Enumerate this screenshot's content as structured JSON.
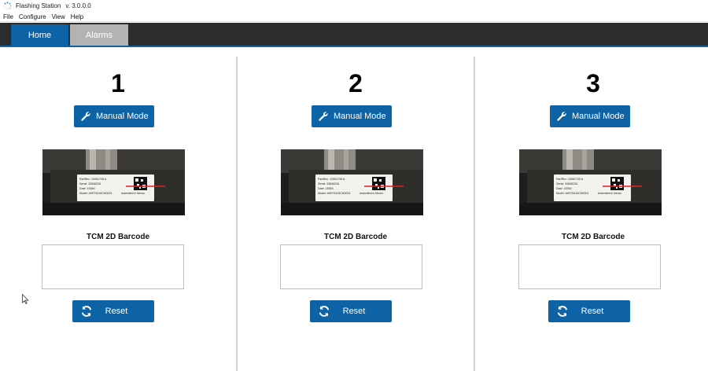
{
  "window": {
    "title": "Flashing Station",
    "version": "v. 3.0.0.0"
  },
  "menu": [
    "File",
    "Configure",
    "View",
    "Help"
  ],
  "tabs": {
    "home": "Home",
    "alarms": "Alarms"
  },
  "colors": {
    "accent": "#0d63a6",
    "tab_inactive": "#b3b3b3",
    "tabbar_bg": "#2c2c2c"
  },
  "stations": [
    {
      "number": "1",
      "manual_label": "Manual Mode",
      "barcode_label": "TCM 2D Barcode",
      "barcode_value": "",
      "reset_label": "Reset",
      "label_lines": [
        "PartRev: 10061735 A",
        "Serial: 33606226",
        "Date: 18364",
        "Model: A9S75416C6D001"
      ],
      "label_footer": "Assembled in Mexico"
    },
    {
      "number": "2",
      "manual_label": "Manual Mode",
      "barcode_label": "TCM 2D Barcode",
      "barcode_value": "",
      "reset_label": "Reset",
      "label_lines": [
        "PartRev: 10061735 A",
        "Serial: 33606226",
        "Date: 18364",
        "Model: A9S75416C6D001"
      ],
      "label_footer": "Assembled in Mexico"
    },
    {
      "number": "3",
      "manual_label": "Manual Mode",
      "barcode_label": "TCM 2D Barcode",
      "barcode_value": "",
      "reset_label": "Reset",
      "label_lines": [
        "PartRev: 10061735 A",
        "Serial: 33606226",
        "Date: 18364",
        "Model: A9S75416C6D001"
      ],
      "label_footer": "Assembled in Mexico"
    }
  ],
  "icons": {
    "manual": "wrench-icon",
    "reset": "refresh-icon",
    "app": "loading-spinner-icon"
  }
}
